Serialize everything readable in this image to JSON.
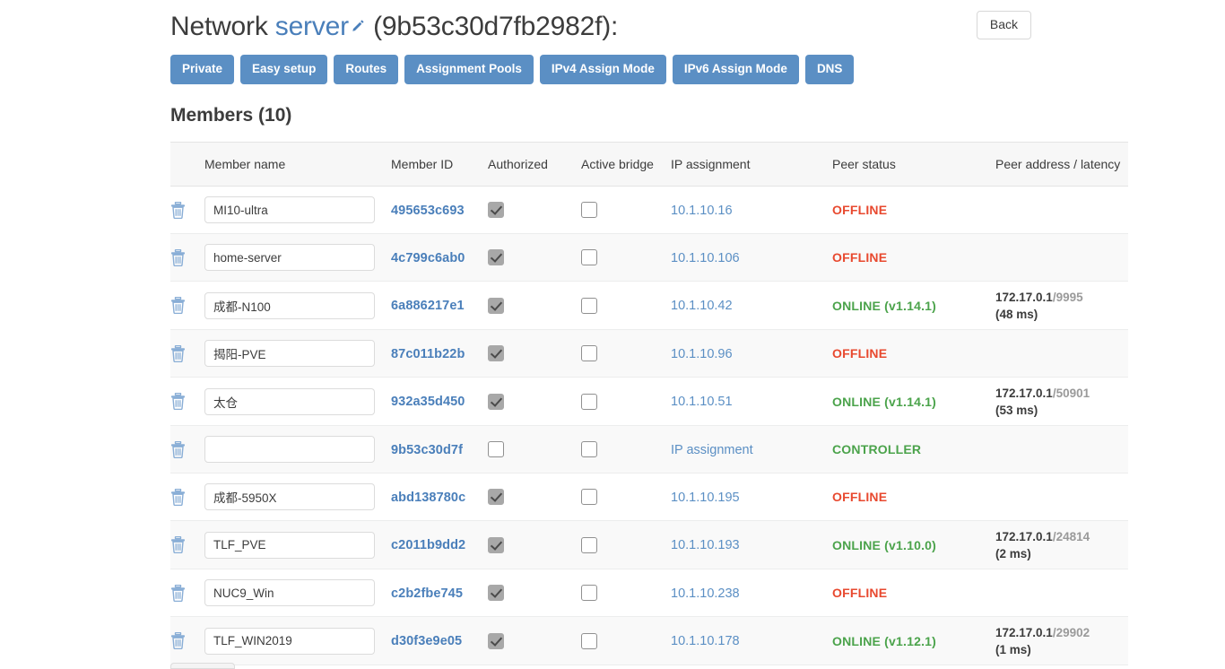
{
  "header": {
    "title_prefix": "Network",
    "network_name": "server",
    "network_id": "(9b53c30d7fb2982f):",
    "edit_icon": "pencil-icon",
    "back_label": "Back"
  },
  "toolbar": {
    "buttons": [
      {
        "label": "Private"
      },
      {
        "label": "Easy setup"
      },
      {
        "label": "Routes"
      },
      {
        "label": "Assignment Pools"
      },
      {
        "label": "IPv4 Assign Mode"
      },
      {
        "label": "IPv6 Assign Mode"
      },
      {
        "label": "DNS"
      }
    ],
    "accent_color": "#5b8fc4"
  },
  "members": {
    "section_title": "Members (10)",
    "columns": [
      "",
      "Member name",
      "Member ID",
      "Authorized",
      "Active bridge",
      "IP assignment",
      "Peer status",
      "Peer address / latency"
    ],
    "delete_icon": "trash-icon",
    "name_placeholder": "",
    "rows": [
      {
        "name": "MI10-ultra",
        "id": "495653c693",
        "authorized": true,
        "bridge": false,
        "ip": "10.1.10.16",
        "status": "OFFLINE",
        "status_type": "offline",
        "peer_host": "",
        "peer_port": "",
        "latency": ""
      },
      {
        "name": "home-server",
        "id": "4c799c6ab0",
        "authorized": true,
        "bridge": false,
        "ip": "10.1.10.106",
        "status": "OFFLINE",
        "status_type": "offline",
        "peer_host": "",
        "peer_port": "",
        "latency": ""
      },
      {
        "name": "成都-N100",
        "id": "6a886217e1",
        "authorized": true,
        "bridge": false,
        "ip": "10.1.10.42",
        "status": "ONLINE (v1.14.1)",
        "status_type": "online",
        "peer_host": "172.17.0.1",
        "peer_port": "/9995",
        "latency": "(48 ms)"
      },
      {
        "name": "揭阳-PVE",
        "id": "87c011b22b",
        "authorized": true,
        "bridge": false,
        "ip": "10.1.10.96",
        "status": "OFFLINE",
        "status_type": "offline",
        "peer_host": "",
        "peer_port": "",
        "latency": ""
      },
      {
        "name": "太仓",
        "id": "932a35d450",
        "authorized": true,
        "bridge": false,
        "ip": "10.1.10.51",
        "status": "ONLINE (v1.14.1)",
        "status_type": "online",
        "peer_host": "172.17.0.1",
        "peer_port": "/50901",
        "latency": "(53 ms)"
      },
      {
        "name": "",
        "id": "9b53c30d7f",
        "authorized": false,
        "bridge": false,
        "ip": "IP assignment",
        "status": "CONTROLLER",
        "status_type": "controller",
        "peer_host": "",
        "peer_port": "",
        "latency": ""
      },
      {
        "name": "成都-5950X",
        "id": "abd138780c",
        "authorized": true,
        "bridge": false,
        "ip": "10.1.10.195",
        "status": "OFFLINE",
        "status_type": "offline",
        "peer_host": "",
        "peer_port": "",
        "latency": ""
      },
      {
        "name": "TLF_PVE",
        "id": "c2011b9dd2",
        "authorized": true,
        "bridge": false,
        "ip": "10.1.10.193",
        "status": "ONLINE (v1.10.0)",
        "status_type": "online",
        "peer_host": "172.17.0.1",
        "peer_port": "/24814",
        "latency": "(2 ms)"
      },
      {
        "name": "NUC9_Win",
        "id": "c2b2fbe745",
        "authorized": true,
        "bridge": false,
        "ip": "10.1.10.238",
        "status": "OFFLINE",
        "status_type": "offline",
        "peer_host": "",
        "peer_port": "",
        "latency": ""
      },
      {
        "name": "TLF_WIN2019",
        "id": "d30f3e9e05",
        "authorized": true,
        "bridge": false,
        "ip": "10.1.10.178",
        "status": "ONLINE (v1.12.1)",
        "status_type": "online",
        "peer_host": "172.17.0.1",
        "peer_port": "/29902",
        "latency": "(1 ms)"
      }
    ]
  },
  "colors": {
    "link": "#4a7fba",
    "offline": "#e8492f",
    "online": "#4ba34b",
    "button": "#5b8fc4"
  }
}
